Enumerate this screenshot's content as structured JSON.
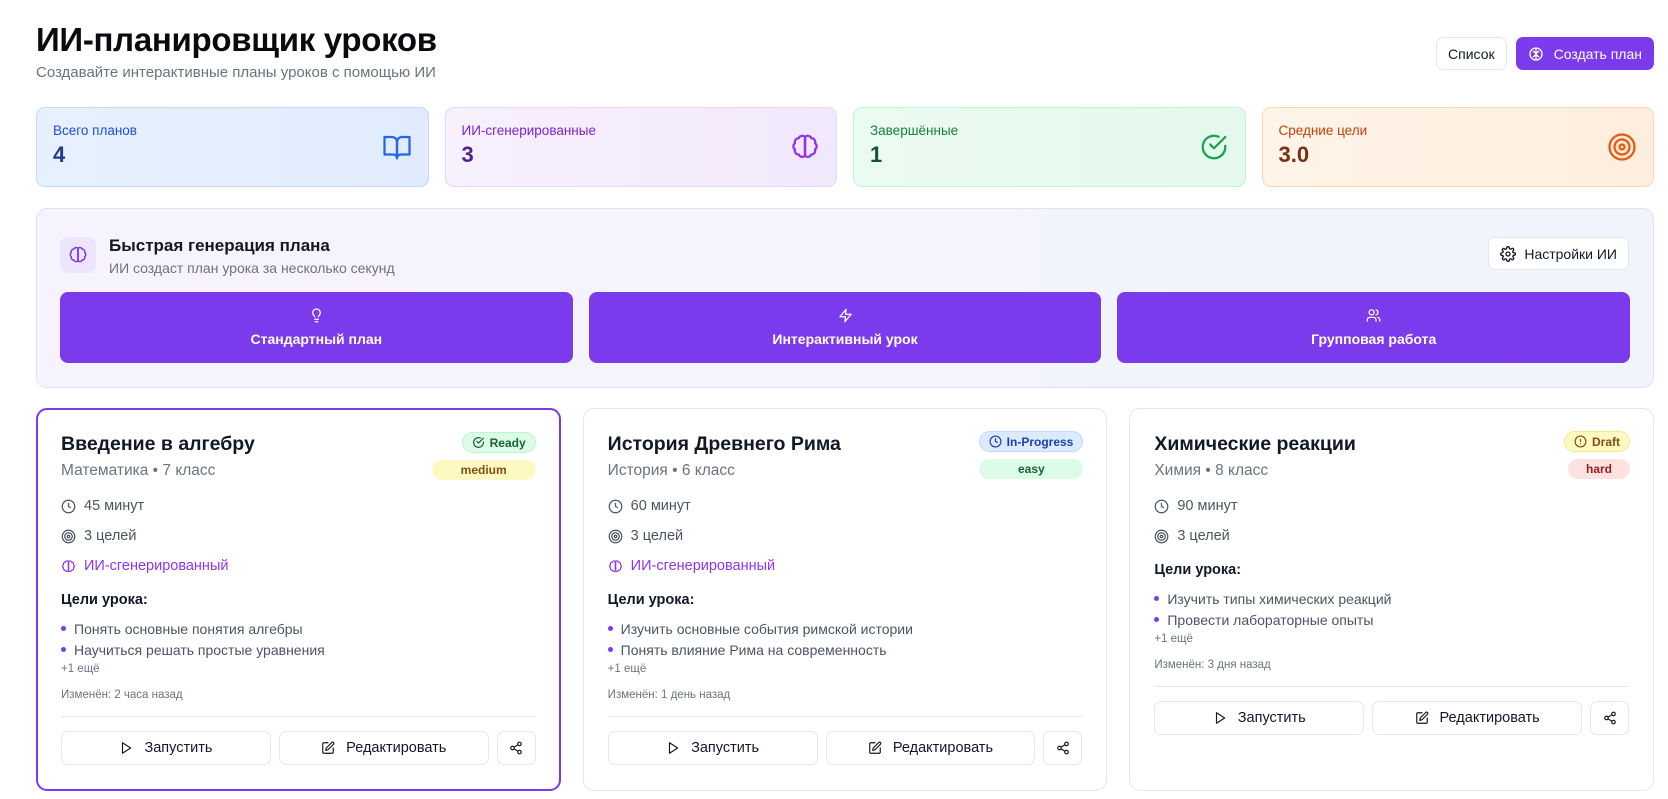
{
  "header": {
    "title": "ИИ-планировщик уроков",
    "subtitle": "Создавайте интерактивные планы уроков с помощью ИИ",
    "list_label": "Список",
    "create_label": "Создать план"
  },
  "stats": [
    {
      "label": "Всего планов",
      "value": "4",
      "icon": "book-open-icon",
      "color": "#2563eb"
    },
    {
      "label": "ИИ-сгенерированные",
      "value": "3",
      "icon": "brain-icon",
      "color": "#9333ea"
    },
    {
      "label": "Завершённые",
      "value": "1",
      "icon": "check-circle-icon",
      "color": "#16a34a"
    },
    {
      "label": "Средние цели",
      "value": "3.0",
      "icon": "target-icon",
      "color": "#ea580c"
    }
  ],
  "quick": {
    "title": "Быстрая генерация плана",
    "subtitle": "ИИ создаст план урока за несколько секунд",
    "settings_label": "Настройки ИИ",
    "buttons": [
      {
        "label": "Стандартный план",
        "icon": "lightbulb-icon"
      },
      {
        "label": "Интерактивный урок",
        "icon": "zap-icon"
      },
      {
        "label": "Групповая работа",
        "icon": "users-icon"
      }
    ]
  },
  "cards": [
    {
      "title": "Введение в алгебру",
      "meta": "Математика • 7 класс",
      "status": "Ready",
      "level": "medium",
      "duration": "45 минут",
      "goals_count": "3 целей",
      "ai_label": "ИИ-сгенерированный",
      "goals_title": "Цели урока:",
      "goals": [
        "Понять основные понятия алгебры",
        "Научиться решать простые уравнения"
      ],
      "more": "+1 ещё",
      "modified": "Изменён: 2 часа назад",
      "run_label": "Запустить",
      "edit_label": "Редактировать"
    },
    {
      "title": "История Древнего Рима",
      "meta": "История • 6 класс",
      "status": "In-Progress",
      "level": "easy",
      "duration": "60 минут",
      "goals_count": "3 целей",
      "ai_label": "ИИ-сгенерированный",
      "goals_title": "Цели урока:",
      "goals": [
        "Изучить основные события римской истории",
        "Понять влияние Рима на современность"
      ],
      "more": "+1 ещё",
      "modified": "Изменён: 1 день назад",
      "run_label": "Запустить",
      "edit_label": "Редактировать"
    },
    {
      "title": "Химические реакции",
      "meta": "Химия • 8 класс",
      "status": "Draft",
      "level": "hard",
      "duration": "90 минут",
      "goals_count": "3 целей",
      "goals_title": "Цели урока:",
      "goals": [
        "Изучить типы химических реакций",
        "Провести лабораторные опыты"
      ],
      "more": "+1 ещё",
      "modified": "Изменён: 3 дня назад",
      "run_label": "Запустить",
      "edit_label": "Редактировать"
    }
  ],
  "colors": {
    "accent": "#7c3aed",
    "ready_bg": "#dcfce7",
    "ready_text": "#166534",
    "progress_bg": "#dbeafe",
    "progress_text": "#1e40af",
    "draft_bg": "#fef9c3",
    "draft_text": "#854d0e",
    "medium_bg": "#fef9c3",
    "easy_bg": "#dcfce7",
    "hard_bg": "#fee2e2"
  }
}
